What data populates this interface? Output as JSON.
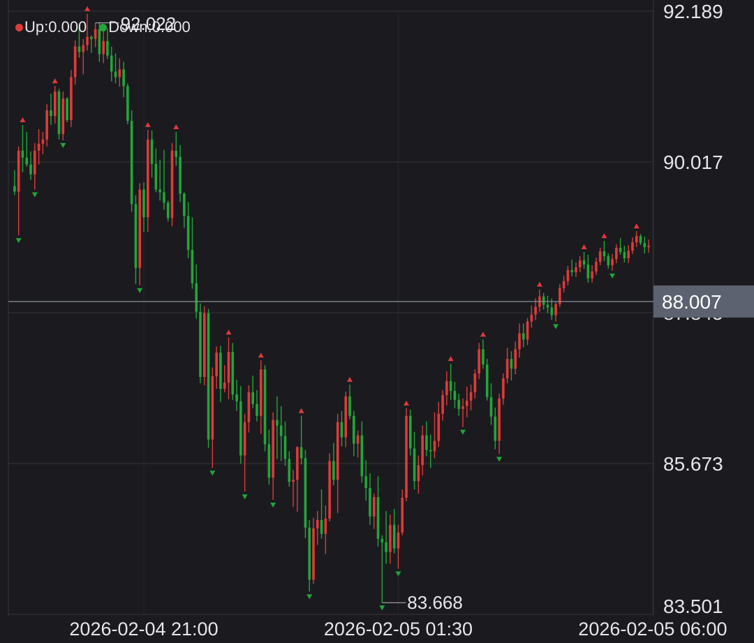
{
  "colors": {
    "background": "#1b1b1f",
    "grid": "#33333a",
    "up": "#e03a3a",
    "down": "#22a63a",
    "axis_text": "#e6e6ea",
    "current_line": "#8a8f99",
    "current_label_bg": "#5c6270"
  },
  "legend": {
    "up_label": "Up:0.000",
    "down_label": "Down:0.000"
  },
  "chart_data": {
    "type": "candlestick",
    "ylim": [
      83.501,
      92.189
    ],
    "y_ticks": [
      "92.189",
      "90.017",
      "87.845",
      "85.673",
      "83.501"
    ],
    "x_ticks": [
      {
        "index": 32,
        "label": "2026-02-04 21:00"
      },
      {
        "index": 95,
        "label": "2026-02-05 01:30"
      },
      {
        "index": 158,
        "label": "2026-02-05 06:00"
      }
    ],
    "current_price": "88.007",
    "high_marker": {
      "index": 20,
      "label": "92.022"
    },
    "low_marker": {
      "index": 91,
      "label": "83.668"
    },
    "ohlc": [
      [
        89.67,
        89.9,
        89.54,
        89.59
      ],
      [
        89.59,
        90.24,
        88.96,
        90.18
      ],
      [
        90.18,
        90.55,
        89.87,
        90.08
      ],
      [
        90.08,
        90.45,
        89.95,
        89.98
      ],
      [
        89.98,
        90.17,
        89.76,
        89.84
      ],
      [
        89.84,
        90.29,
        89.62,
        90.18
      ],
      [
        90.18,
        90.49,
        89.98,
        90.28
      ],
      [
        90.28,
        90.45,
        90.13,
        90.34
      ],
      [
        90.34,
        90.85,
        90.24,
        90.76
      ],
      [
        90.76,
        91.0,
        90.55,
        90.68
      ],
      [
        90.68,
        91.11,
        90.57,
        91.03
      ],
      [
        91.03,
        91.07,
        90.34,
        90.42
      ],
      [
        90.42,
        91.03,
        90.33,
        90.93
      ],
      [
        90.93,
        90.95,
        90.59,
        90.62
      ],
      [
        90.62,
        91.34,
        90.52,
        91.24
      ],
      [
        91.24,
        91.77,
        91.13,
        91.68
      ],
      [
        91.68,
        91.98,
        91.52,
        91.6
      ],
      [
        91.6,
        91.79,
        91.28,
        91.7
      ],
      [
        91.7,
        92.15,
        91.62,
        91.82
      ],
      [
        91.82,
        91.84,
        91.59,
        91.79
      ],
      [
        91.79,
        92.02,
        91.67,
        91.93
      ],
      [
        91.93,
        92.03,
        91.46,
        91.57
      ],
      [
        91.57,
        91.97,
        91.44,
        91.76
      ],
      [
        91.76,
        91.94,
        91.5,
        91.55
      ],
      [
        91.55,
        91.68,
        91.18,
        91.32
      ],
      [
        91.32,
        91.58,
        91.15,
        91.24
      ],
      [
        91.24,
        91.51,
        91.1,
        91.35
      ],
      [
        91.35,
        91.46,
        90.95,
        91.11
      ],
      [
        91.11,
        91.15,
        90.56,
        90.61
      ],
      [
        90.61,
        90.76,
        89.3,
        89.41
      ],
      [
        89.41,
        89.54,
        88.26,
        88.49
      ],
      [
        88.49,
        89.71,
        88.24,
        89.62
      ],
      [
        89.62,
        89.72,
        89.01,
        89.22
      ],
      [
        89.22,
        90.48,
        89.01,
        90.34
      ],
      [
        90.34,
        90.47,
        89.79,
        89.99
      ],
      [
        89.99,
        90.21,
        89.58,
        89.62
      ],
      [
        89.62,
        90.05,
        89.46,
        89.58
      ],
      [
        89.58,
        90.19,
        89.33,
        89.43
      ],
      [
        89.43,
        89.46,
        89.16,
        89.21
      ],
      [
        89.21,
        90.29,
        89.09,
        90.18
      ],
      [
        90.18,
        90.45,
        89.96,
        90.09
      ],
      [
        90.09,
        90.26,
        89.44,
        89.56
      ],
      [
        89.56,
        89.58,
        89.07,
        89.24
      ],
      [
        89.24,
        89.44,
        88.63,
        88.75
      ],
      [
        88.75,
        89.22,
        88.19,
        88.27
      ],
      [
        88.27,
        88.54,
        87.76,
        87.86
      ],
      [
        87.86,
        87.98,
        86.83,
        86.92
      ],
      [
        86.92,
        87.94,
        86.8,
        87.84
      ],
      [
        87.84,
        87.9,
        85.9,
        86.02
      ],
      [
        86.02,
        87.06,
        85.61,
        86.93
      ],
      [
        86.93,
        87.36,
        86.75,
        87.27
      ],
      [
        87.27,
        87.37,
        86.56,
        86.75
      ],
      [
        86.75,
        87.09,
        86.7,
        86.84
      ],
      [
        86.84,
        87.49,
        86.6,
        87.28
      ],
      [
        87.28,
        87.41,
        86.59,
        86.67
      ],
      [
        86.67,
        86.88,
        86.43,
        86.57
      ],
      [
        86.57,
        86.79,
        85.67,
        85.79
      ],
      [
        85.79,
        86.39,
        85.27,
        86.27
      ],
      [
        86.27,
        86.8,
        86.12,
        86.7
      ],
      [
        86.7,
        86.94,
        86.47,
        86.53
      ],
      [
        86.53,
        86.73,
        86.28,
        86.36
      ],
      [
        86.36,
        87.16,
        86.1,
        87.03
      ],
      [
        87.03,
        87.09,
        85.85,
        85.95
      ],
      [
        85.95,
        86.16,
        85.37,
        85.47
      ],
      [
        85.47,
        86.41,
        85.15,
        86.3
      ],
      [
        86.3,
        86.64,
        85.74,
        86.22
      ],
      [
        86.22,
        86.5,
        85.71,
        86.07
      ],
      [
        86.07,
        86.28,
        85.64,
        85.74
      ],
      [
        85.74,
        85.85,
        85.34,
        85.41
      ],
      [
        85.41,
        85.58,
        85.05,
        85.44
      ],
      [
        85.44,
        85.92,
        84.98,
        85.91
      ],
      [
        85.91,
        86.36,
        85.66,
        85.75
      ],
      [
        85.75,
        85.87,
        84.6,
        84.75
      ],
      [
        84.75,
        84.86,
        83.83,
        84.0
      ],
      [
        84.0,
        84.89,
        83.94,
        84.74
      ],
      [
        84.74,
        84.99,
        84.5,
        84.86
      ],
      [
        84.86,
        85.3,
        84.59,
        84.66
      ],
      [
        84.66,
        85.07,
        84.37,
        84.88
      ],
      [
        84.88,
        85.82,
        84.84,
        85.71
      ],
      [
        85.71,
        85.97,
        85.36,
        85.44
      ],
      [
        85.44,
        86.39,
        84.96,
        86.27
      ],
      [
        86.27,
        86.43,
        85.92,
        86.05
      ],
      [
        86.05,
        86.71,
        85.91,
        86.64
      ],
      [
        86.64,
        86.81,
        86.31,
        86.36
      ],
      [
        86.36,
        86.43,
        85.78,
        85.96
      ],
      [
        85.96,
        86.15,
        85.76,
        86.08
      ],
      [
        86.08,
        86.28,
        85.4,
        85.49
      ],
      [
        85.49,
        85.72,
        85.14,
        85.32
      ],
      [
        85.32,
        85.53,
        84.79,
        84.91
      ],
      [
        84.91,
        85.24,
        84.73,
        85.19
      ],
      [
        85.19,
        85.49,
        84.48,
        84.59
      ],
      [
        84.59,
        84.64,
        83.67,
        84.54
      ],
      [
        84.54,
        84.99,
        84.23,
        84.4
      ],
      [
        84.4,
        84.94,
        84.23,
        84.79
      ],
      [
        84.79,
        85.02,
        84.38,
        84.45
      ],
      [
        84.45,
        84.79,
        84.16,
        84.68
      ],
      [
        84.68,
        85.3,
        84.64,
        85.18
      ],
      [
        85.18,
        86.47,
        85.13,
        86.36
      ],
      [
        86.36,
        86.45,
        85.79,
        85.89
      ],
      [
        85.89,
        86.13,
        85.3,
        85.42
      ],
      [
        85.42,
        85.79,
        85.24,
        85.65
      ],
      [
        85.65,
        86.22,
        85.5,
        86.08
      ],
      [
        86.08,
        86.28,
        85.78,
        85.87
      ],
      [
        85.87,
        86.09,
        85.61,
        85.85
      ],
      [
        85.85,
        86.41,
        85.75,
        86.0
      ],
      [
        86.0,
        86.56,
        85.91,
        86.39
      ],
      [
        86.39,
        86.73,
        86.29,
        86.66
      ],
      [
        86.66,
        87.0,
        86.51,
        86.86
      ],
      [
        86.86,
        87.11,
        86.59,
        86.72
      ],
      [
        86.72,
        86.85,
        86.47,
        86.59
      ],
      [
        86.59,
        86.68,
        86.36,
        86.46
      ],
      [
        86.46,
        86.61,
        86.2,
        86.5
      ],
      [
        86.5,
        86.78,
        86.34,
        86.58
      ],
      [
        86.58,
        86.81,
        86.44,
        86.7
      ],
      [
        86.7,
        87.03,
        86.61,
        86.97
      ],
      [
        86.97,
        87.41,
        86.89,
        87.32
      ],
      [
        87.32,
        87.46,
        87.04,
        87.1
      ],
      [
        87.1,
        87.18,
        86.58,
        86.63
      ],
      [
        86.63,
        86.83,
        86.23,
        86.35
      ],
      [
        86.35,
        86.48,
        85.88,
        86.0
      ],
      [
        86.0,
        86.68,
        85.81,
        86.61
      ],
      [
        86.61,
        86.97,
        86.52,
        86.9
      ],
      [
        86.9,
        87.34,
        86.83,
        87.18
      ],
      [
        87.18,
        87.29,
        86.87,
        87.04
      ],
      [
        87.04,
        87.43,
        86.96,
        87.32
      ],
      [
        87.32,
        87.69,
        87.2,
        87.55
      ],
      [
        87.55,
        87.69,
        87.35,
        87.46
      ],
      [
        87.46,
        87.77,
        87.38,
        87.72
      ],
      [
        87.72,
        87.95,
        87.63,
        87.82
      ],
      [
        87.82,
        88.05,
        87.74,
        87.93
      ],
      [
        87.93,
        88.18,
        87.86,
        88.08
      ],
      [
        88.08,
        88.13,
        87.89,
        87.96
      ],
      [
        87.96,
        88.09,
        87.84,
        87.92
      ],
      [
        87.92,
        88.05,
        87.74,
        87.81
      ],
      [
        87.81,
        88.0,
        87.72,
        87.97
      ],
      [
        87.97,
        88.26,
        87.93,
        88.2
      ],
      [
        88.2,
        88.38,
        88.14,
        88.3
      ],
      [
        88.3,
        88.52,
        88.24,
        88.46
      ],
      [
        88.46,
        88.61,
        88.37,
        88.43
      ],
      [
        88.43,
        88.57,
        88.36,
        88.5
      ],
      [
        88.5,
        88.66,
        88.43,
        88.6
      ],
      [
        88.6,
        88.72,
        88.48,
        88.54
      ],
      [
        88.54,
        88.68,
        88.28,
        88.34
      ],
      [
        88.34,
        88.53,
        88.28,
        88.44
      ],
      [
        88.44,
        88.64,
        88.39,
        88.58
      ],
      [
        88.58,
        88.78,
        88.53,
        88.73
      ],
      [
        88.73,
        88.88,
        88.59,
        88.66
      ],
      [
        88.66,
        88.7,
        88.48,
        88.53
      ],
      [
        88.53,
        88.69,
        88.45,
        88.62
      ],
      [
        88.62,
        88.83,
        88.56,
        88.78
      ],
      [
        88.78,
        88.92,
        88.68,
        88.72
      ],
      [
        88.72,
        88.81,
        88.57,
        88.63
      ],
      [
        88.63,
        88.82,
        88.56,
        88.74
      ],
      [
        88.74,
        88.93,
        88.69,
        88.86
      ],
      [
        88.86,
        89.02,
        88.79,
        88.95
      ],
      [
        88.95,
        88.98,
        88.82,
        88.85
      ],
      [
        88.85,
        88.94,
        88.7,
        88.79
      ],
      [
        88.79,
        88.9,
        88.71,
        88.81
      ]
    ]
  }
}
